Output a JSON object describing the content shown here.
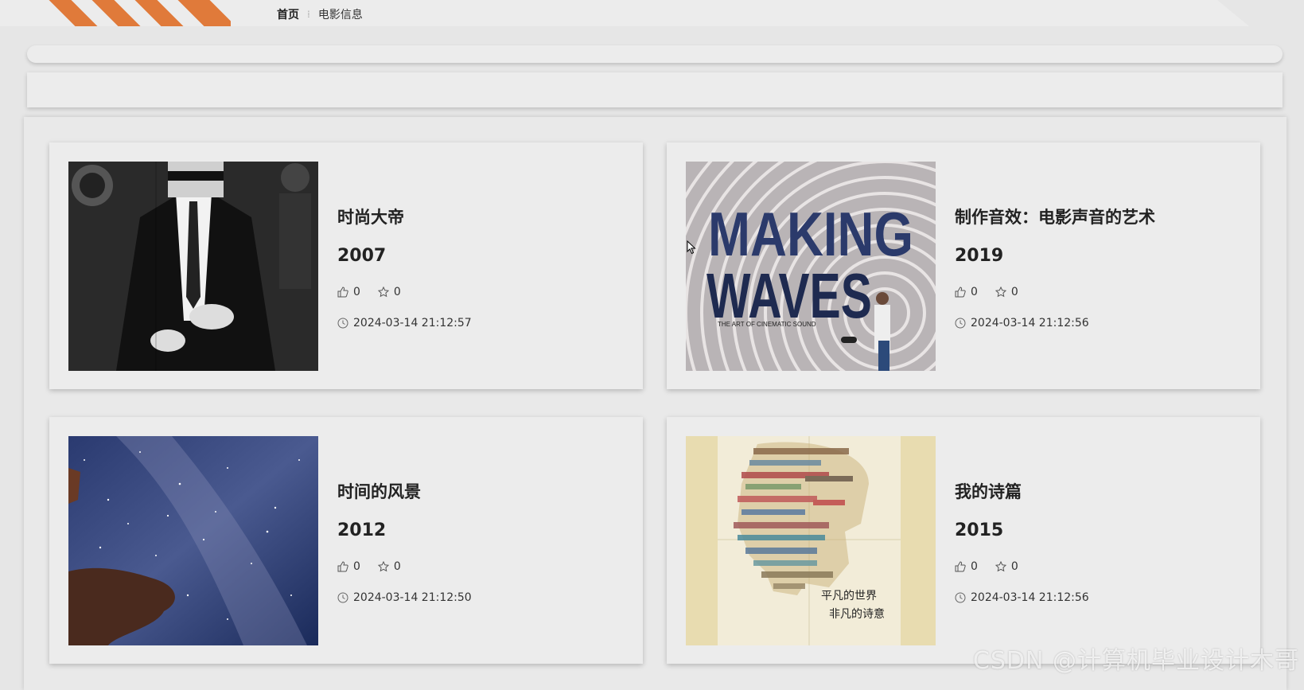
{
  "breadcrumb": {
    "home": "首页",
    "current": "电影信息"
  },
  "movies": [
    {
      "title": "时尚大帝",
      "year": "2007",
      "likes": "0",
      "favorites": "0",
      "time": "2024-03-14 21:12:57"
    },
    {
      "title": "制作音效：电影声音的艺术",
      "year": "2019",
      "likes": "0",
      "favorites": "0",
      "time": "2024-03-14 21:12:56",
      "poster_text": {
        "line1": "MAKING",
        "line2": "WAVES",
        "subtitle": "THE ART OF CINEMATIC SOUND"
      }
    },
    {
      "title": "时间的风景",
      "year": "2012",
      "likes": "0",
      "favorites": "0",
      "time": "2024-03-14 21:12:50"
    },
    {
      "title": "我的诗篇",
      "year": "2015",
      "likes": "0",
      "favorites": "0",
      "time": "2024-03-14 21:12:56",
      "poster_text": {
        "line1": "平凡的世界",
        "line2": "非凡的诗意"
      }
    }
  ],
  "watermark": "CSDN @计算机毕业设计木哥",
  "colors": {
    "accent": "#e07a3a",
    "background": "#e6e6e6",
    "card": "#ececec"
  }
}
